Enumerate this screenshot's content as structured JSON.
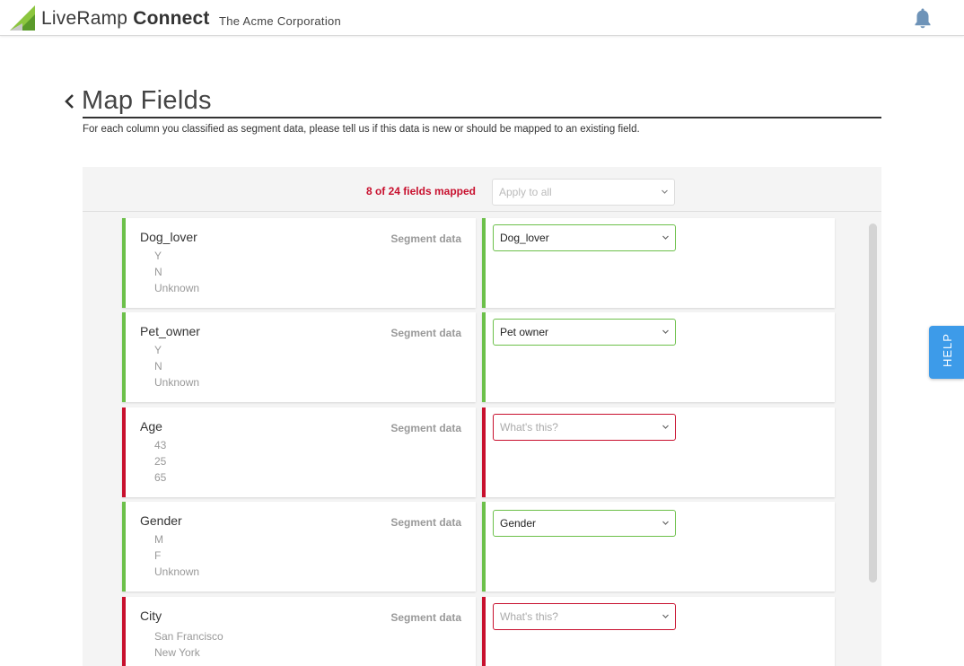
{
  "header": {
    "brand_light": "LiveRamp",
    "brand_bold": "Connect",
    "company": "The Acme Corporation"
  },
  "page": {
    "title": "Map Fields",
    "subtitle": "For each column you classified as segment data, please tell us if this data is new or should be mapped to an existing field."
  },
  "panel": {
    "mapped_count": "8 of 24 fields mapped",
    "apply_all_placeholder": "Apply to all"
  },
  "rows": [
    {
      "name": "Dog_lover",
      "type": "Segment data",
      "samples": [
        "Y",
        "N",
        "Unknown"
      ],
      "mapping": "Dog_lover",
      "status": "mapped"
    },
    {
      "name": "Pet_owner",
      "type": "Segment data",
      "samples": [
        "Y",
        "N",
        "Unknown"
      ],
      "mapping": "Pet owner",
      "status": "mapped"
    },
    {
      "name": "Age",
      "type": "Segment data",
      "samples": [
        "43",
        "25",
        "65"
      ],
      "mapping": "What's this?",
      "status": "unmapped"
    },
    {
      "name": "Gender",
      "type": "Segment data",
      "samples": [
        "M",
        "F",
        "Unknown"
      ],
      "mapping": "Gender",
      "status": "mapped"
    },
    {
      "name": "City",
      "type": "Segment data",
      "samples": [
        "San Francisco",
        "New York"
      ],
      "mapping": "What's this?",
      "status": "unmapped"
    }
  ],
  "help": {
    "label": "HELP"
  },
  "colors": {
    "mapped": "#6cc04a",
    "unmapped": "#c8102e",
    "help": "#3d9be9"
  },
  "icons": {
    "logo": "liveramp-logo-icon",
    "notifications": "bell-icon",
    "back": "chevron-left-icon",
    "dropdown": "chevron-down-icon"
  }
}
